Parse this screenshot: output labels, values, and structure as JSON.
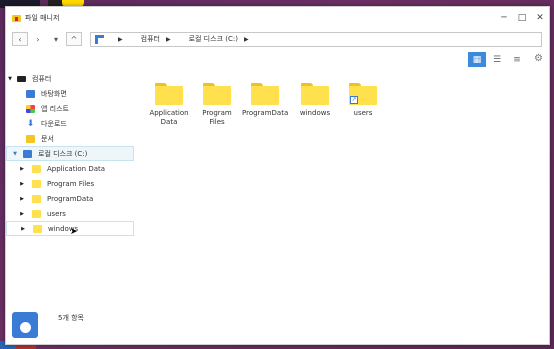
{
  "window": {
    "title": "파일 매니저"
  },
  "controls": {
    "minimize": "─",
    "maximize": "□",
    "close": "✕"
  },
  "nav": {
    "back": "‹",
    "forward": "›",
    "dropdown": "▾",
    "up": "^"
  },
  "address": {
    "crumbs": [
      "컴퓨터",
      "로컬 디스크 (C:)"
    ]
  },
  "views": {
    "icons": "▦",
    "list": "☰",
    "details": "≡",
    "settings": "⚙"
  },
  "tree": {
    "computer": "컴퓨터",
    "desktop": "바탕화면",
    "apps": "앱 리스트",
    "downloads": "다운로드",
    "documents": "문서",
    "local_disk": "로컬 디스크 (C:)",
    "children": [
      "Application Data",
      "Program Files",
      "ProgramData",
      "users",
      "windows"
    ]
  },
  "content": {
    "items": [
      {
        "name": "Application Data",
        "shortcut": false
      },
      {
        "name": "Program Files",
        "shortcut": false
      },
      {
        "name": "ProgramData",
        "shortcut": false
      },
      {
        "name": "windows",
        "shortcut": false
      },
      {
        "name": "users",
        "shortcut": true
      }
    ]
  },
  "status": {
    "count": "5개 항목"
  }
}
